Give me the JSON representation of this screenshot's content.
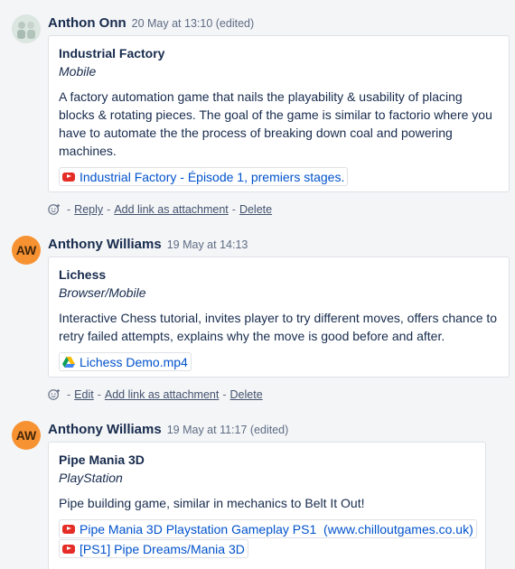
{
  "comments": [
    {
      "author": "Anthon Onn",
      "date": "20 May at 13:10 (edited)",
      "avatar_initials": "",
      "card": {
        "title": "Industrial Factory",
        "subtitle": "Mobile",
        "body": "A factory automation game that nails the playability & usability of placing blocks & rotating pieces. The goal of the game is similar to factorio where you have to automate the the process of breaking down coal and powering machines.",
        "links": [
          {
            "icon": "youtube-icon",
            "label": "Industrial Factory - Épisode 1, premiers stages."
          }
        ]
      },
      "actions": [
        "Reply",
        "Add link as attachment",
        "Delete"
      ]
    },
    {
      "author": "Anthony Williams",
      "date": "19 May at 14:13",
      "avatar_initials": "AW",
      "card": {
        "title": "Lichess",
        "subtitle": "Browser/Mobile",
        "body": "Interactive Chess tutorial, invites player to try different moves, offers chance to retry failed attempts, explains why the move is good before and after.",
        "links": [
          {
            "icon": "google-drive-icon",
            "label": "Lichess Demo.mp4"
          }
        ]
      },
      "actions": [
        "Edit",
        "Add link as attachment",
        "Delete"
      ]
    },
    {
      "author": "Anthony Williams",
      "date": "19 May at 11:17 (edited)",
      "avatar_initials": "AW",
      "card": {
        "title": "Pipe Mania 3D",
        "subtitle": "PlayStation",
        "body": "Pipe building game, similar in mechanics to Belt It Out!",
        "links": [
          {
            "icon": "youtube-icon",
            "label": "Pipe Mania 3D Playstation Gameplay PS1  (www.chilloutgames.co.uk)"
          },
          {
            "icon": "youtube-icon",
            "label": "[PS1] Pipe Dreams/Mania 3D"
          }
        ]
      },
      "actions": []
    }
  ],
  "separator": "-",
  "colors": {
    "avatar_orange": "#f79232",
    "link": "#0052cc",
    "youtube": "#e52d27"
  }
}
